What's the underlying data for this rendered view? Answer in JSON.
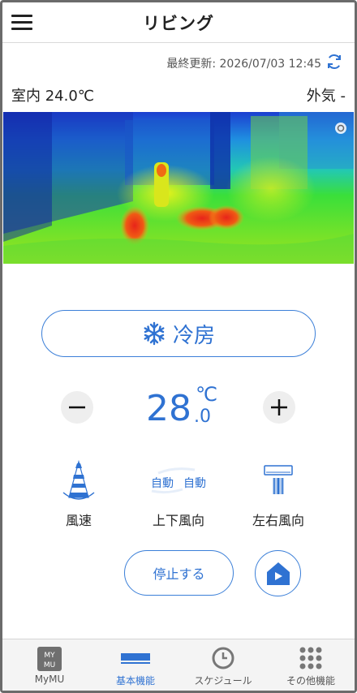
{
  "header": {
    "title": "リビング"
  },
  "status": {
    "last_updated": "最終更新: 2026/07/03 12:45",
    "indoor_temp": "室内 24.0℃",
    "outdoor_temp": "外気 -"
  },
  "mode": {
    "label": "冷房"
  },
  "setpoint": {
    "integer": "28",
    "decimal": ".0",
    "unit": "℃"
  },
  "controls": {
    "fan_label": "風速",
    "vertical_label": "上下風向",
    "vertical_auto_1": "自動",
    "vertical_auto_2": "自動",
    "horizontal_label": "左右風向"
  },
  "actions": {
    "stop_label": "停止する"
  },
  "tabs": [
    {
      "label": "MyMU",
      "icon_text": "MY MU"
    },
    {
      "label": "基本機能"
    },
    {
      "label": "スケジュール"
    },
    {
      "label": "その他機能"
    }
  ],
  "colors": {
    "accent": "#2f72d2",
    "header_text": "#222222",
    "tab_bg": "#f4f4f4"
  },
  "icons": [
    "menu-icon",
    "refresh-icon",
    "camera-icon",
    "snowflake-icon",
    "minus-icon",
    "plus-icon",
    "fan-speed-icon",
    "vertical-vane-icon",
    "horizontal-vane-icon",
    "home-play-icon",
    "mymu-icon",
    "basic-functions-icon",
    "clock-icon",
    "grid-icon"
  ]
}
